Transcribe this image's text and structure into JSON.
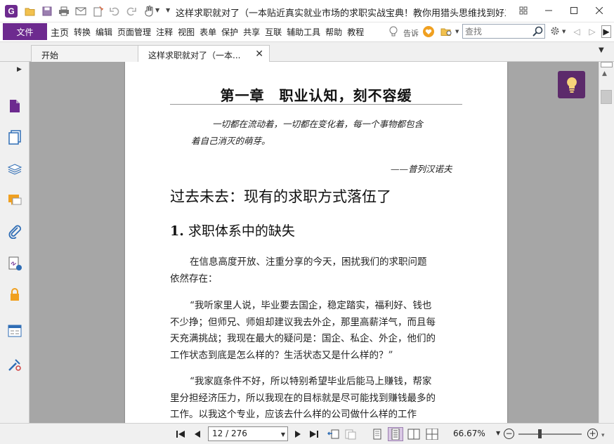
{
  "app": {
    "logo_letter": "G",
    "window_title": "这样求职就对了（一本贴近真实就业市场的求职实战宝典！教你用猎头思维找到好工作..."
  },
  "quick_access": {
    "icons": [
      "open-folder-icon",
      "save-icon",
      "print-icon",
      "email-icon",
      "new-icon",
      "undo-icon",
      "redo-icon",
      "hand-tool-icon"
    ]
  },
  "menu": {
    "file_label": "文件",
    "items": [
      "主页",
      "转换",
      "编辑",
      "页面管理",
      "注释",
      "视图",
      "表单",
      "保护",
      "共享",
      "互联",
      "辅助工具",
      "帮助",
      "教程"
    ],
    "tell_me": "告诉",
    "search_placeholder": "查找"
  },
  "tabs": {
    "start": "开始",
    "document": "这样求职就对了（一本..."
  },
  "page": {
    "chapter_title": "第一章　职业认知，刻不容缓",
    "epigraph_line1": "一切都在流动着，一切都在变化着，每一个事物都包含",
    "epigraph_line2": "着自己消灭的萌芽。",
    "epigraph_author": "——普列汉诺夫",
    "section_heading": "过去未去：现有的求职方式落伍了",
    "subsection_number": "1.",
    "subsection_heading": "求职体系中的缺失",
    "para1": [
      "在信息高度开放、注重分享的今天，困扰我们的求职问题",
      "依然存在："
    ],
    "para2": [
      "“我听家里人说，毕业要去国企，稳定踏实，福利好、钱也",
      "不少挣；但师兄、师姐却建议我去外企，那里高薪洋气，而且每",
      "天充满挑战；我现在最大的疑问是：国企、私企、外企，他们的",
      "工作状态到底是怎么样的？生活状态又是什么样的？”"
    ],
    "para3": [
      "“我家庭条件不好，所以特别希望毕业后能马上赚钱，帮家",
      "里分担经济压力，所以我现在的目标就是尽可能找到赚钱最多的",
      "工作。以我这个专业，应该去什么样的公司做什么样的工作"
    ]
  },
  "statusbar": {
    "current_page": "12 / 276",
    "zoom": "66.67%"
  },
  "colors": {
    "brand": "#6d2a8f",
    "tips_button": "#5c2a6b",
    "doc_background": "#a6a6a6"
  }
}
